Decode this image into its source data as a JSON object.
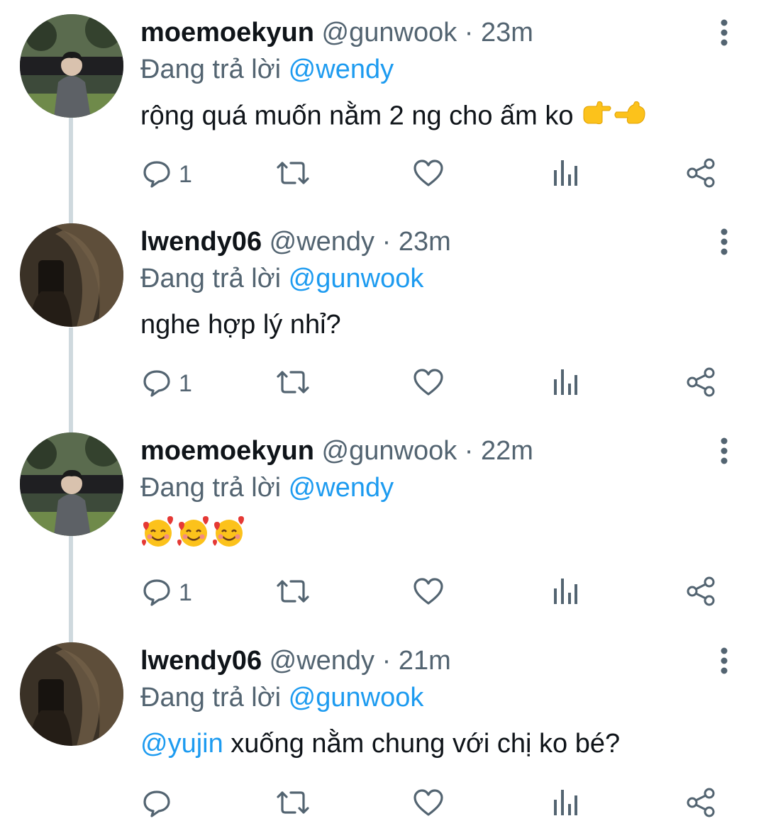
{
  "tweets": [
    {
      "name": "moemoekyun",
      "handle": "@gunwook",
      "dot": "·",
      "time": "23m",
      "reply_prefix": "Đang trả lời",
      "reply_to": "@wendy",
      "text": "rộng quá muốn nằm 2 ng cho ấm ko",
      "text_mention": "",
      "emoji": [
        "backhand-index-right",
        "backhand-index-right"
      ],
      "reply_count": "1",
      "avatar": "person-photo-dark"
    },
    {
      "name": "lwendy06",
      "handle": "@wendy",
      "dot": "·",
      "time": "23m",
      "reply_prefix": "Đang trả lời",
      "reply_to": "@gunwook",
      "text": "nghe hợp lý nhỉ?",
      "text_mention": "",
      "emoji": [],
      "reply_count": "1",
      "avatar": "phone-silhouette-photo"
    },
    {
      "name": "moemoekyun",
      "handle": "@gunwook",
      "dot": "·",
      "time": "22m",
      "reply_prefix": "Đang trả lời",
      "reply_to": "@wendy",
      "text": "",
      "text_mention": "",
      "emoji": [
        "smiling-face-with-hearts",
        "smiling-face-with-hearts",
        "smiling-face-with-hearts"
      ],
      "reply_count": "1",
      "avatar": "person-photo-dark"
    },
    {
      "name": "lwendy06",
      "handle": "@wendy",
      "dot": "·",
      "time": "21m",
      "reply_prefix": "Đang trả lời",
      "reply_to": "@gunwook",
      "text": " xuống nằm chung với chị ko bé?",
      "text_mention": "@yujin",
      "emoji": [],
      "reply_count": "",
      "avatar": "phone-silhouette-photo"
    }
  ],
  "icons": {
    "reply": "reply-icon",
    "retweet": "retweet-icon",
    "like": "like-icon",
    "analytics": "analytics-icon",
    "share": "share-icon",
    "more": "more-vertical-icon"
  },
  "colors": {
    "text": "#0f1419",
    "secondary": "#536471",
    "mention": "#1d9bf0",
    "thread_line": "#cfd9de"
  }
}
